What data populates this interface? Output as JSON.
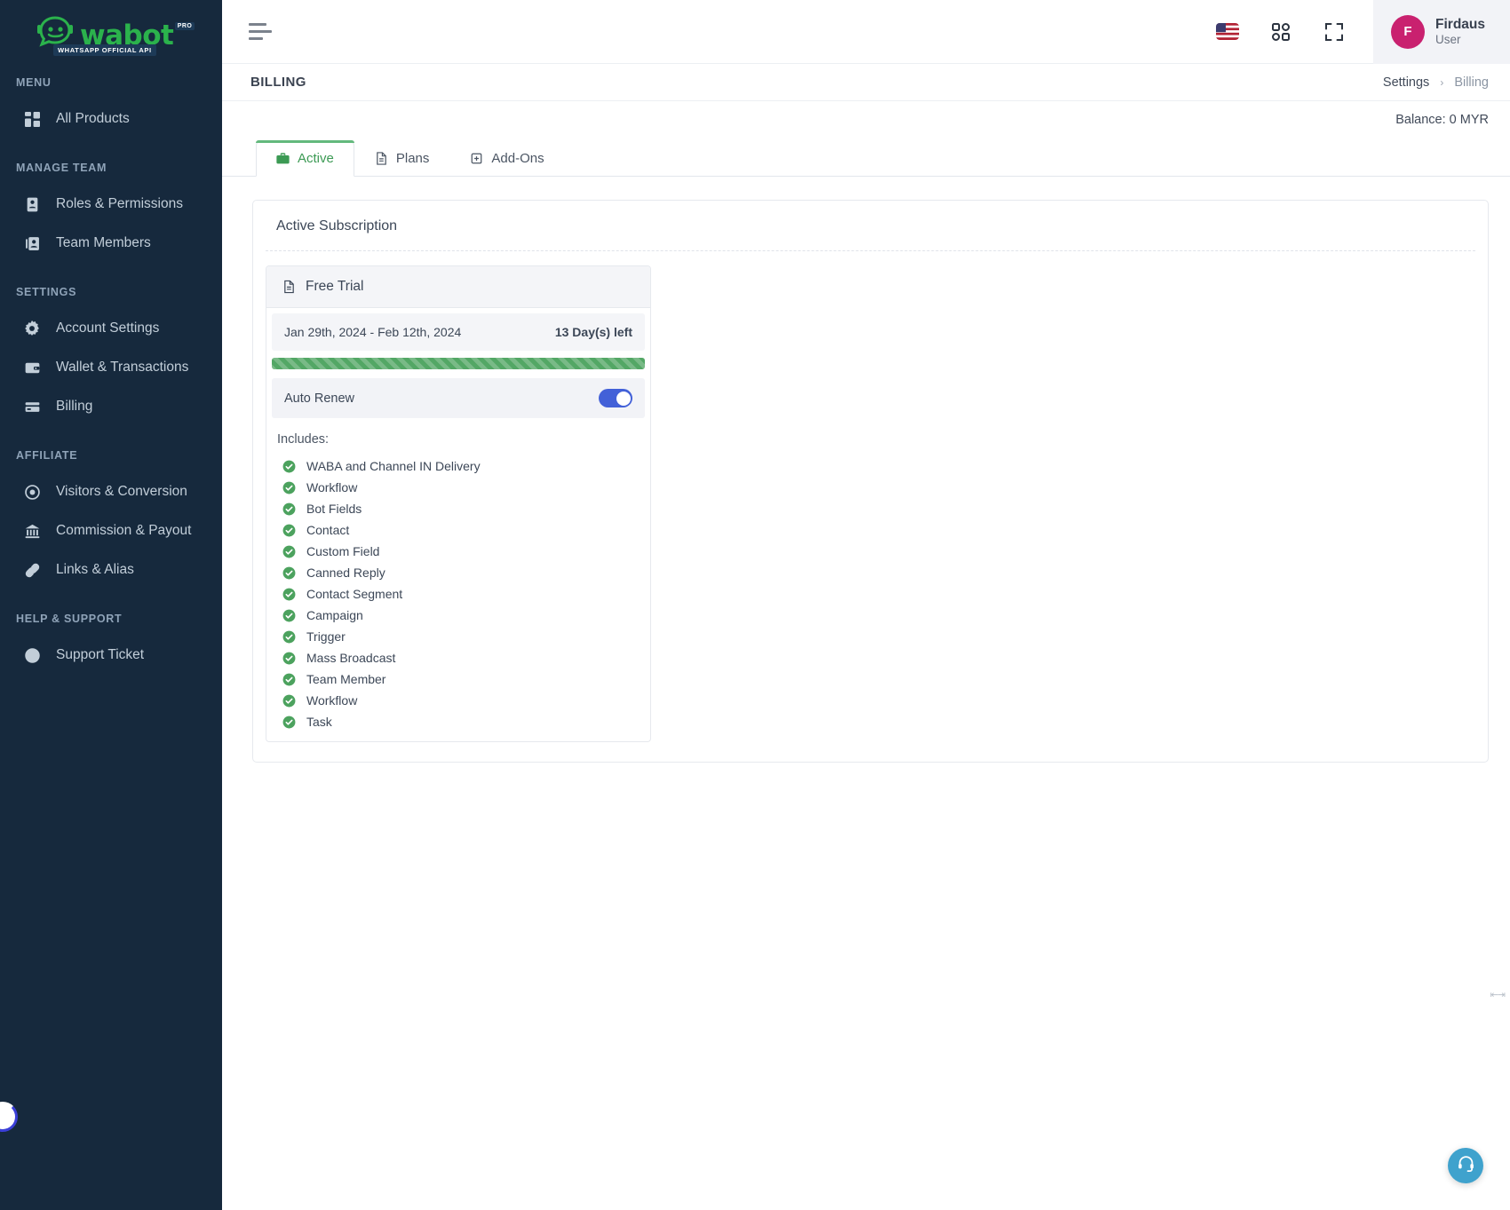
{
  "brand": {
    "word": "wabot",
    "pro_badge": "PRO",
    "subtitle": "WHATSAPP OFFICIAL API",
    "green": "#2bb24c",
    "sidebar_bg": "#16293d"
  },
  "sidebar": {
    "sections": [
      {
        "title": "MENU",
        "items": [
          {
            "label": "All Products",
            "icon": "grid-icon"
          }
        ]
      },
      {
        "title": "MANAGE TEAM",
        "items": [
          {
            "label": "Roles & Permissions",
            "icon": "id-card-icon"
          },
          {
            "label": "Team Members",
            "icon": "users-card-icon"
          }
        ]
      },
      {
        "title": "SETTINGS",
        "items": [
          {
            "label": "Account Settings",
            "icon": "gear-icon"
          },
          {
            "label": "Wallet & Transactions",
            "icon": "wallet-icon"
          },
          {
            "label": "Billing",
            "icon": "credit-card-icon"
          }
        ]
      },
      {
        "title": "AFFILIATE",
        "items": [
          {
            "label": "Visitors & Conversion",
            "icon": "eye-icon"
          },
          {
            "label": "Commission & Payout",
            "icon": "bank-icon"
          },
          {
            "label": "Links & Alias",
            "icon": "link-icon"
          }
        ]
      },
      {
        "title": "HELP & SUPPORT",
        "items": [
          {
            "label": "Support Ticket",
            "icon": "lifebuoy-icon"
          }
        ]
      }
    ]
  },
  "topbar": {
    "menu_toggle": "hamburger-icon",
    "language_flag": "us-flag-icon",
    "apps_icon": "apps-grid-icon",
    "fullscreen_icon": "fullscreen-icon",
    "user": {
      "name": "Firdaus",
      "role": "User",
      "initial": "F",
      "avatar_color": "#c9216f"
    }
  },
  "page": {
    "title": "BILLING",
    "breadcrumb": {
      "parent": "Settings",
      "separator": "›",
      "current": "Billing"
    },
    "balance": "Balance: 0 MYR"
  },
  "tabs": [
    {
      "label": "Active",
      "icon": "briefcase-icon",
      "active": true
    },
    {
      "label": "Plans",
      "icon": "document-icon",
      "active": false
    },
    {
      "label": "Add-Ons",
      "icon": "plus-square-icon",
      "active": false
    }
  ],
  "subscription": {
    "card_title": "Active Subscription",
    "plan_name": "Free Trial",
    "plan_icon": "document-icon",
    "date_range": "Jan 29th, 2024 - Feb 12th, 2024",
    "days_left": "13 Day(s) left",
    "progress_percent": 100,
    "progress_color": "#53a765",
    "auto_renew_label": "Auto Renew",
    "auto_renew_on": true,
    "toggle_color": "#4361d8",
    "includes_label": "Includes:",
    "features": [
      "WABA and Channel IN Delivery",
      "Workflow",
      "Bot Fields",
      "Contact",
      "Custom Field",
      "Canned Reply",
      "Contact Segment",
      "Campaign",
      "Trigger",
      "Mass Broadcast",
      "Team Member",
      "Workflow",
      "Task"
    ]
  },
  "support_widget": {
    "icon": "headset-icon",
    "color": "#3fa2cd"
  }
}
